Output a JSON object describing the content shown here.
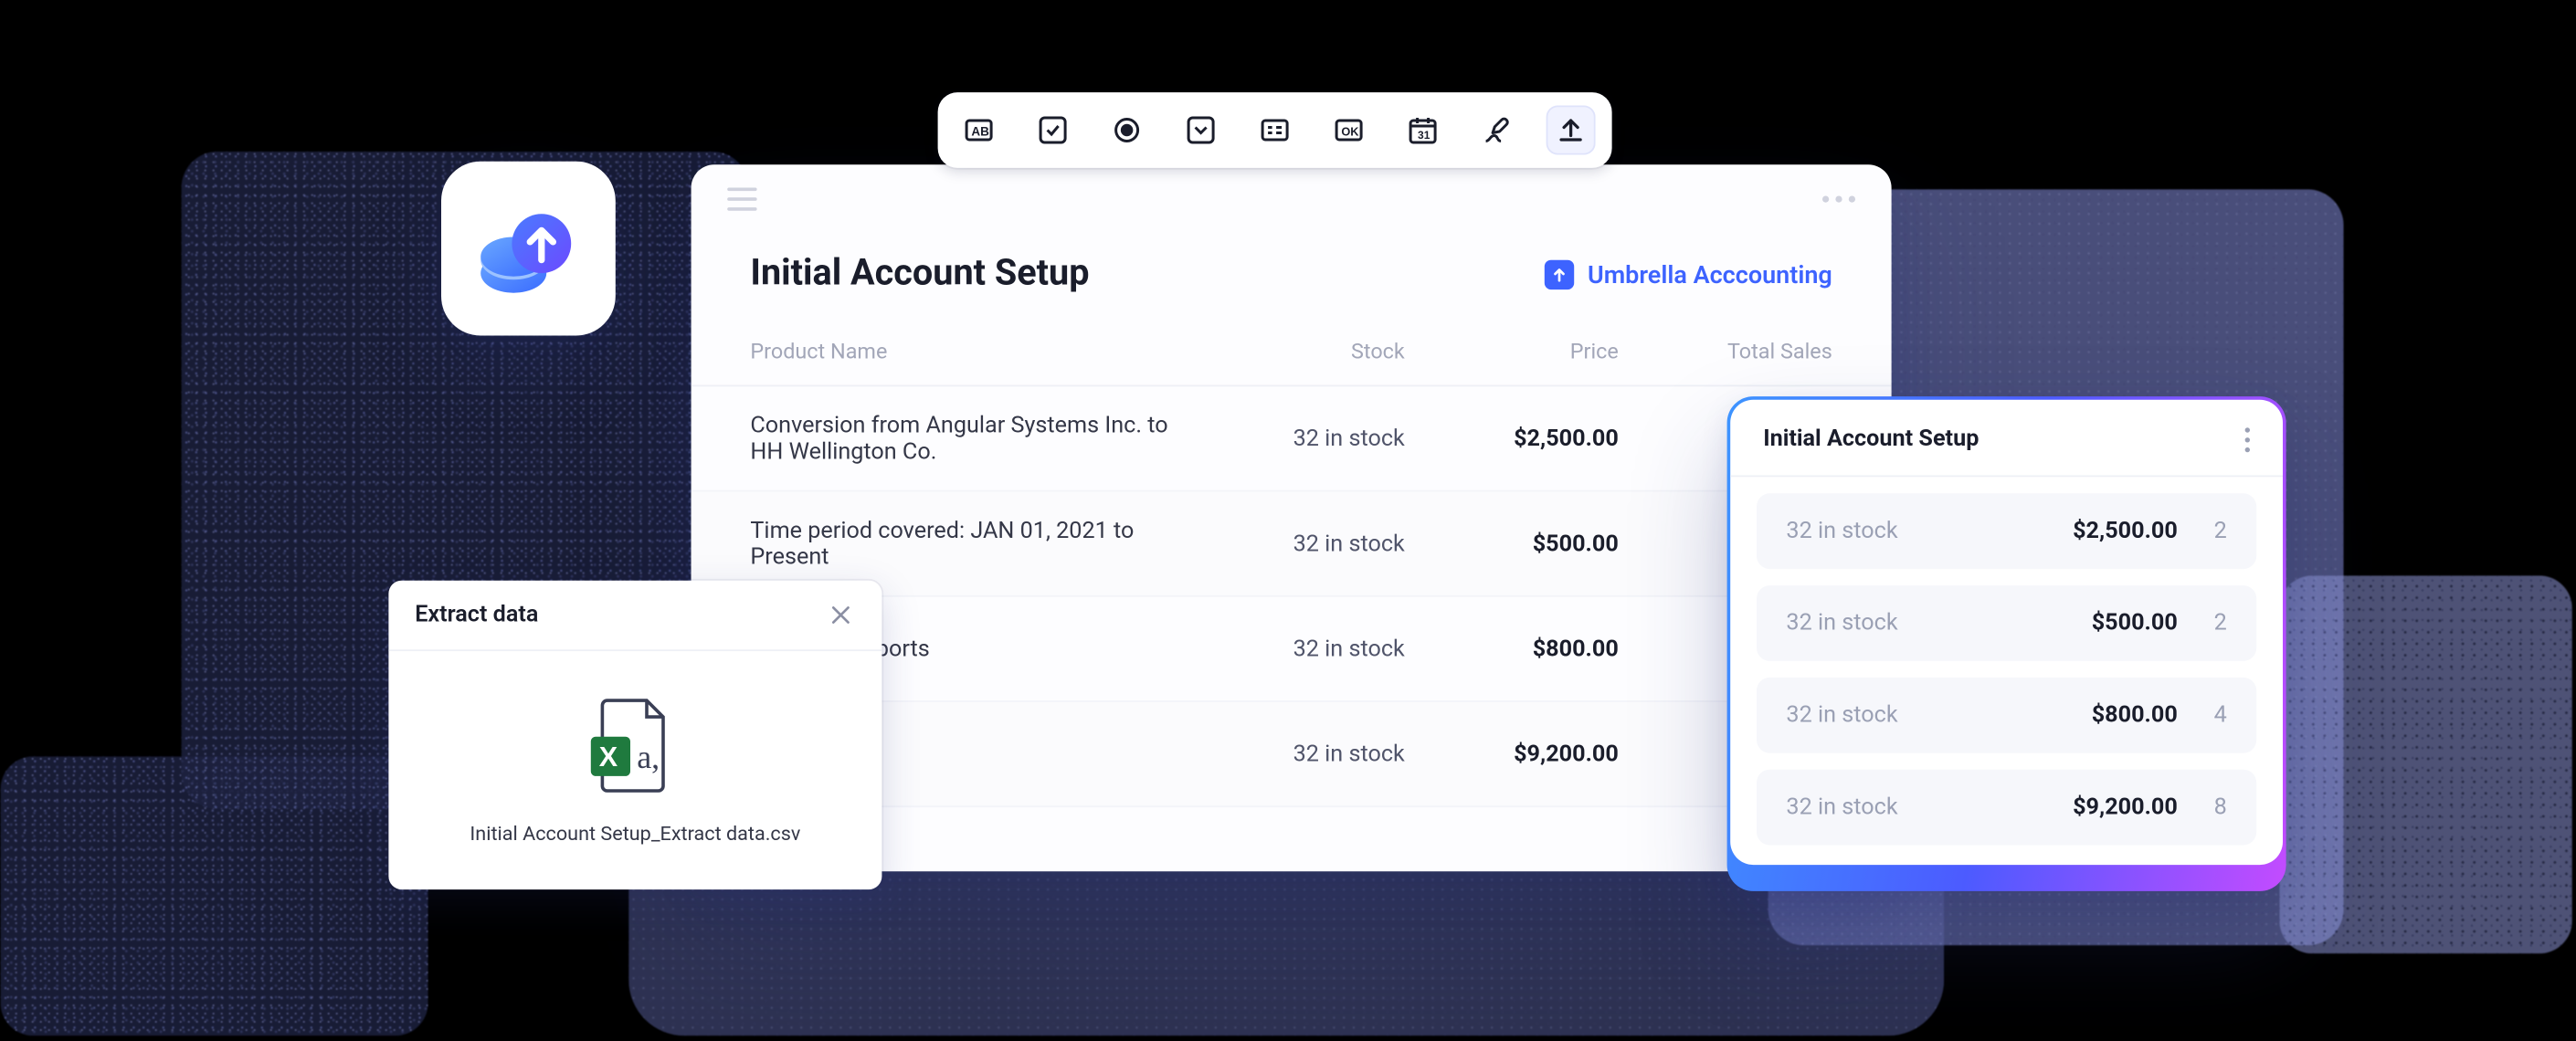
{
  "toolbar": {
    "icons": [
      "ab",
      "check",
      "radio",
      "dropdown",
      "form",
      "ok",
      "calendar",
      "sign",
      "upload"
    ],
    "selected": "upload"
  },
  "main": {
    "title": "Initial Account Setup",
    "brand": "Umbrella Acccounting",
    "columns": [
      "Product Name",
      "Stock",
      "Price",
      "Total Sales"
    ],
    "rows": [
      {
        "name": "Conversion from Angular Systems Inc. to HH Wellington Co.",
        "stock": "32 in stock",
        "price": "$2,500.00",
        "total": ""
      },
      {
        "name": "Time period covered: JAN 01, 2021 to Present",
        "stock": "32 in stock",
        "price": "$500.00",
        "total": ""
      },
      {
        "name": "Quarterly Reports",
        "stock": "32 in stock",
        "price": "$800.00",
        "total": ""
      },
      {
        "name": "",
        "stock": "32 in stock",
        "price": "$9,200.00",
        "total": ""
      }
    ]
  },
  "extract": {
    "title": "Extract data",
    "filename": "Initial Account Setup_Extract data.csv"
  },
  "summary": {
    "title": "Initial Account Setup",
    "rows": [
      {
        "stock": "32 in stock",
        "price": "$2,500.00",
        "count": "2"
      },
      {
        "stock": "32 in stock",
        "price": "$500.00",
        "count": "2"
      },
      {
        "stock": "32 in stock",
        "price": "$800.00",
        "count": "4"
      },
      {
        "stock": "32 in stock",
        "price": "$9,200.00",
        "count": "8"
      }
    ]
  }
}
